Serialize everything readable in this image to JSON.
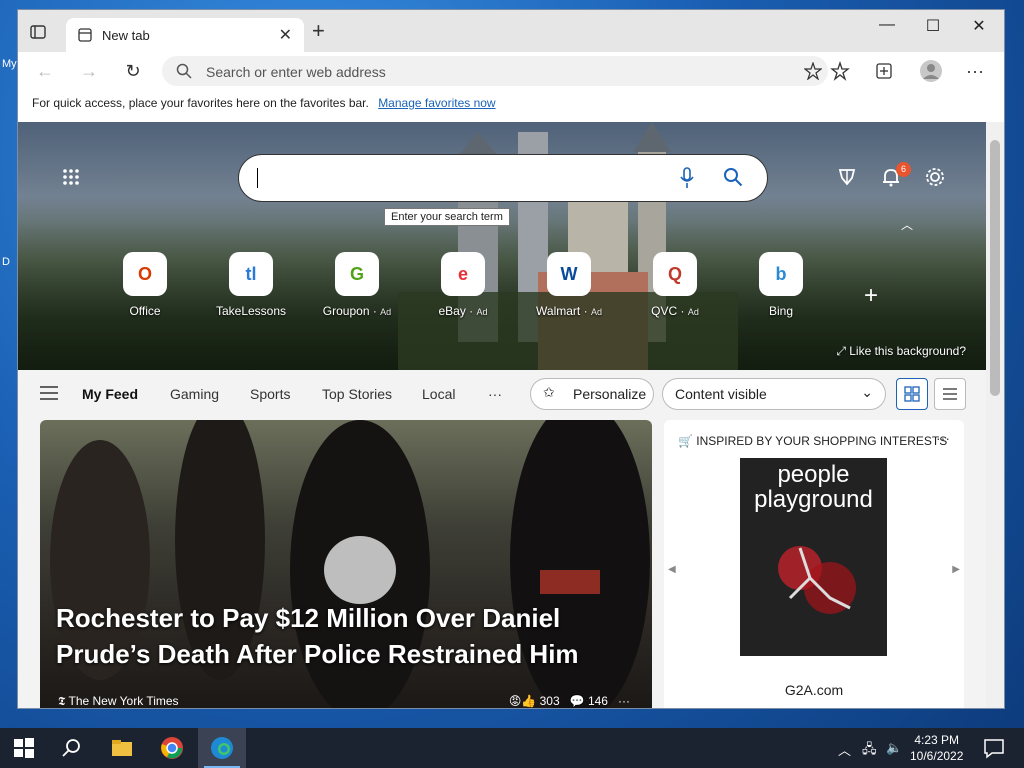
{
  "desktop": {
    "labels": [
      "My",
      "D"
    ]
  },
  "tab": {
    "title": "New tab",
    "close": "✕"
  },
  "toolbar": {
    "newtab": "+",
    "minimize": "—",
    "maximize": "☐",
    "close": "✕"
  },
  "address": {
    "placeholder": "Search or enter web address"
  },
  "favbar": {
    "message": "For quick access, place your favorites here on the favorites bar.",
    "link": "Manage favorites now"
  },
  "hero": {
    "tooltip": "Enter your search term",
    "notifications_count": "6",
    "like_background": "Like this background?",
    "add_tile": "+"
  },
  "tiles": [
    {
      "label": "Office",
      "ad": "",
      "glyph": "O",
      "color": "#d83b01"
    },
    {
      "label": "TakeLessons",
      "ad": "",
      "glyph": "tl",
      "color": "#2b7bd4"
    },
    {
      "label": "Groupon",
      "ad": "Ad",
      "glyph": "G",
      "color": "#53a318"
    },
    {
      "label": "eBay",
      "ad": "Ad",
      "glyph": "e",
      "color": "#e53238"
    },
    {
      "label": "Walmart",
      "ad": "Ad",
      "glyph": "W",
      "color": "#0a4a9c"
    },
    {
      "label": "QVC",
      "ad": "Ad",
      "glyph": "Q",
      "color": "#c0392b"
    },
    {
      "label": "Bing",
      "ad": "",
      "glyph": "b",
      "color": "#2a8ad4"
    }
  ],
  "feed": {
    "items": [
      "My Feed",
      "Gaming",
      "Sports",
      "Top Stories",
      "Local"
    ],
    "more": "···",
    "personalize": "Personalize",
    "content_visible": "Content visible"
  },
  "article": {
    "headline": "Rochester to Pay $12 Million Over Daniel Prude’s Death After Police Restrained Him",
    "source": "The New York Times",
    "reactions": "303",
    "comments": "146",
    "more": "···"
  },
  "ad": {
    "header": "INSPIRED BY YOUR SHOPPING INTERESTS",
    "more": "···",
    "poster_text": "people playground",
    "site": "G2A.com"
  },
  "clock": {
    "time": "4:23 PM",
    "date": "10/6/2022"
  }
}
